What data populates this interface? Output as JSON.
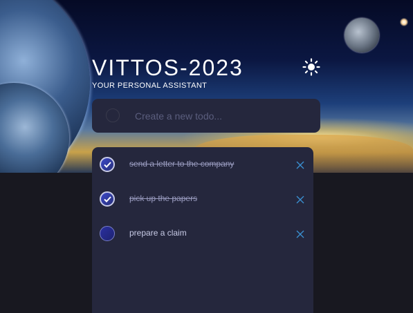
{
  "header": {
    "title": "VITTOS-2023",
    "subtitle": "YOUR PERSONAL ASSISTANT",
    "theme_toggle_icon": "sun-icon"
  },
  "new_todo": {
    "placeholder": "Create a new todo..."
  },
  "todos": [
    {
      "text": "send a letter to the company",
      "completed": true
    },
    {
      "text": "pick up the papers",
      "completed": true
    },
    {
      "text": "prepare a claim",
      "completed": false
    }
  ],
  "colors": {
    "background": "#181820",
    "card": "#25273d",
    "text": "#c8cbe7",
    "accent": "#3a8fd0"
  }
}
